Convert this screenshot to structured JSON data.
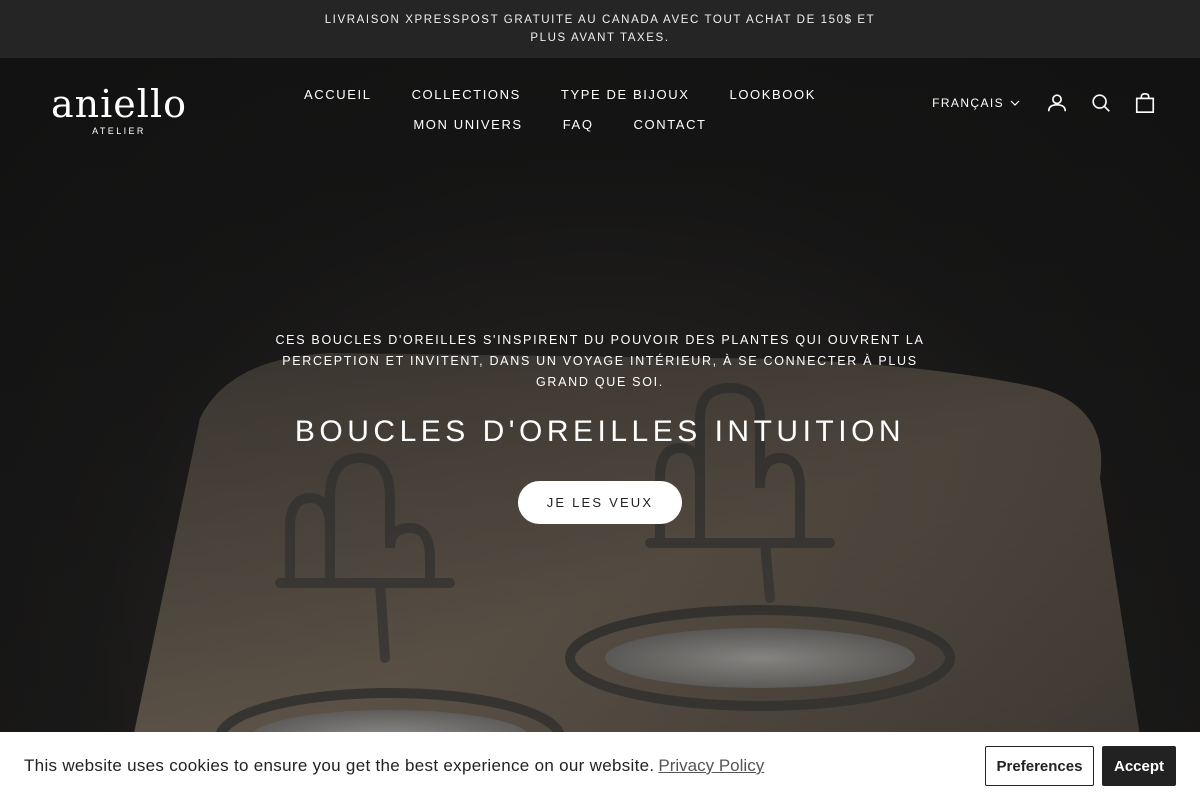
{
  "announcement": {
    "text": "LIVRAISON XPRESSPOST GRATUITE AU CANADA AVEC TOUT ACHAT DE 150$ ET PLUS AVANT TAXES."
  },
  "header": {
    "logo_word": "aniello",
    "logo_sub": "ATELIER",
    "nav": [
      {
        "label": "ACCUEIL"
      },
      {
        "label": "COLLECTIONS"
      },
      {
        "label": "TYPE DE BIJOUX"
      },
      {
        "label": "LOOKBOOK"
      },
      {
        "label": "MON UNIVERS"
      },
      {
        "label": "FAQ"
      },
      {
        "label": "CONTACT"
      }
    ],
    "language": "FRANÇAIS",
    "icons": [
      "account-icon",
      "search-icon",
      "cart-icon"
    ]
  },
  "hero": {
    "description": "CES BOUCLES D'OREILLES S'INSPIRENT DU POUVOIR DES PLANTES QUI OUVRENT LA PERCEPTION ET INVITENT, DANS UN VOYAGE INTÉRIEUR, À SE CONNECTER À PLUS GRAND QUE SOI.",
    "title": "BOUCLES D'OREILLES INTUITION",
    "cta": "JE LES VEUX"
  },
  "cookie": {
    "message": "This website uses cookies to ensure you get the best experience on our website.",
    "link": "Privacy Policy",
    "preferences": "Preferences",
    "accept": "Accept"
  },
  "colors": {
    "announcement_bg": "#252525",
    "hero_overlay": "#1b1b1b",
    "cta_bg": "#ffffff",
    "accept_bg": "#222222"
  }
}
